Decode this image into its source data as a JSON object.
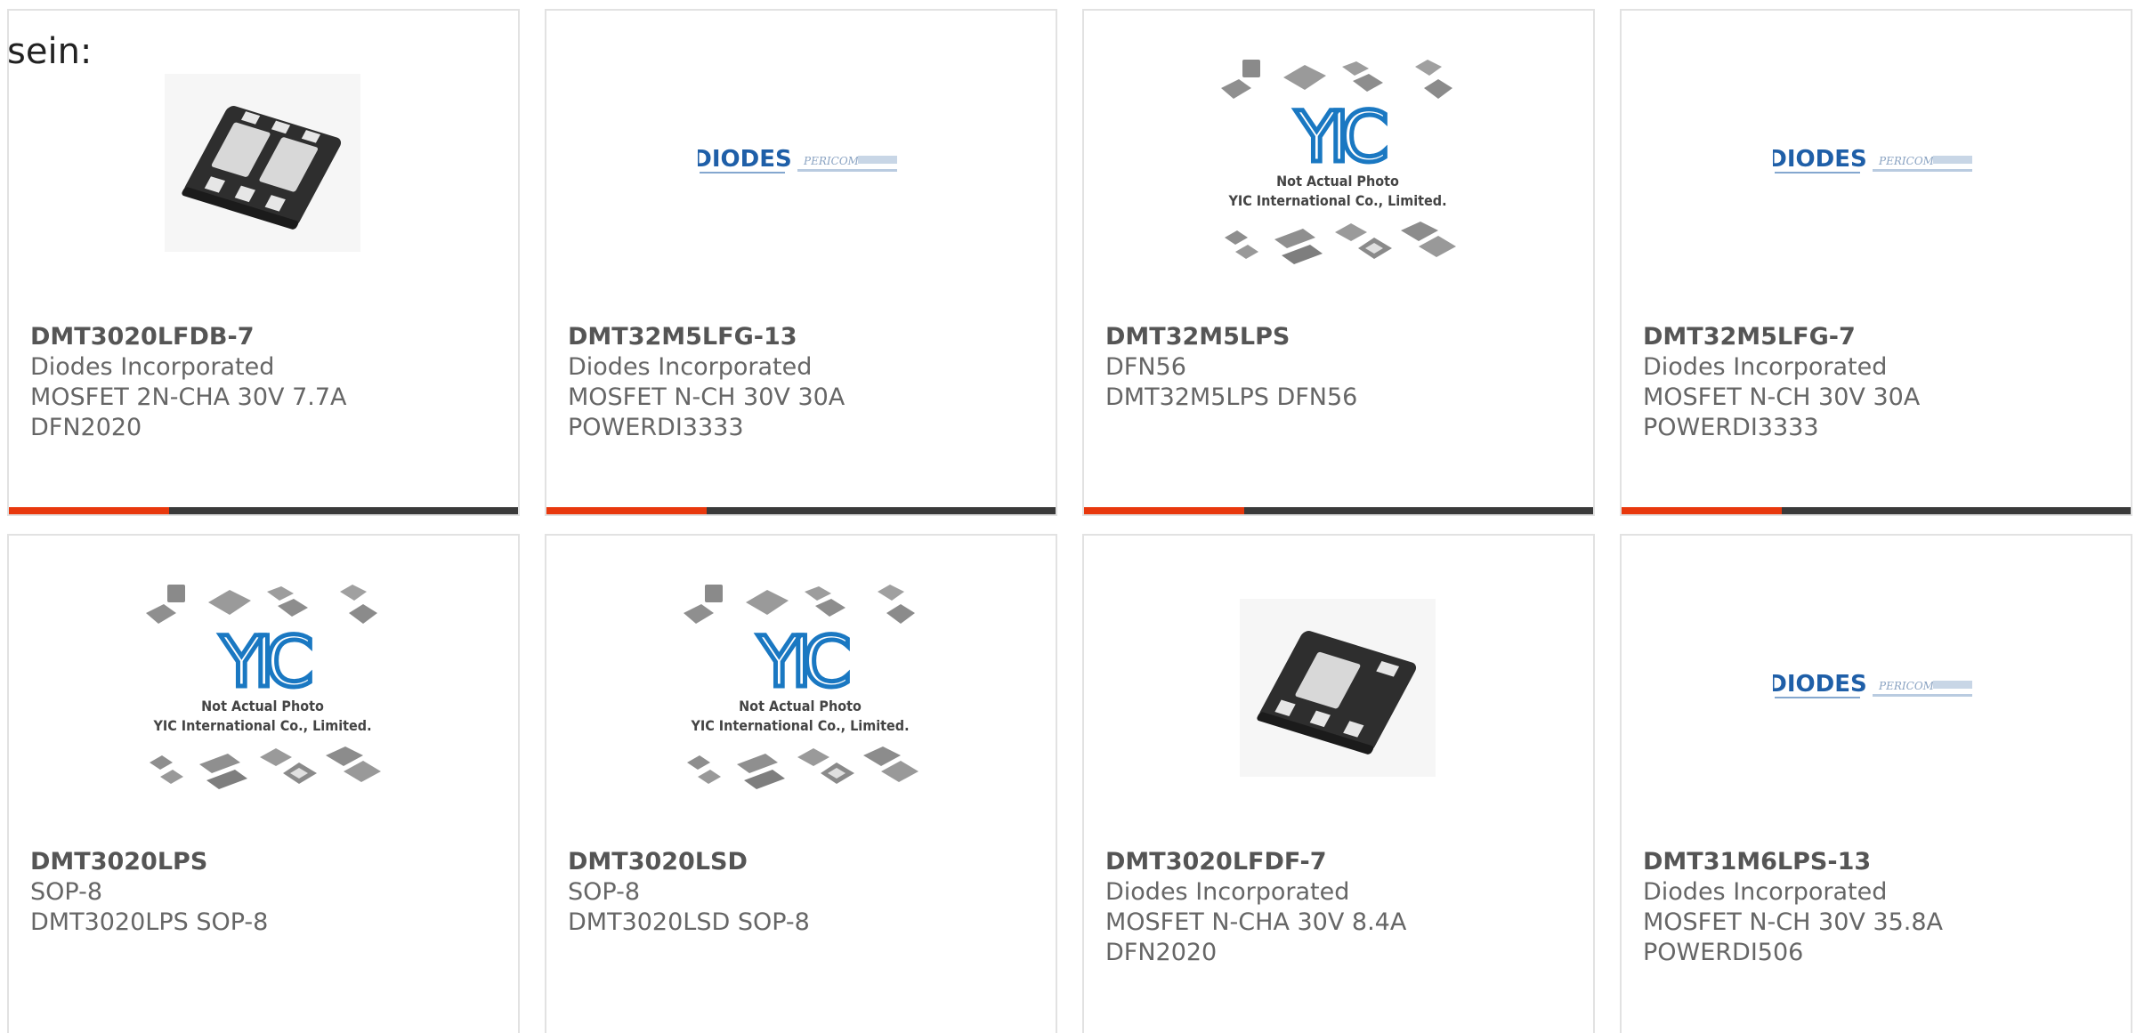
{
  "intro_text": "sein:",
  "products": [
    {
      "part": "DMT3020LFDB-7",
      "lines": [
        "Diodes Incorporated",
        "MOSFET 2N-CHA 30V 7.7A",
        "DFN2020"
      ],
      "image": "chip-6pad"
    },
    {
      "part": "DMT32M5LFG-13",
      "lines": [
        "Diodes Incorporated",
        "MOSFET N-CH 30V 30A",
        "POWERDI3333"
      ],
      "image": "diodes-pericom-logo",
      "logo": {
        "brand": "DIODES",
        "sub": "PERICOM"
      }
    },
    {
      "part": "DMT32M5LPS",
      "lines": [
        "DFN56",
        "DMT32M5LPS DFN56"
      ],
      "image": "yic-placeholder",
      "placeholder": {
        "logo": "YIC",
        "line1": "Not Actual Photo",
        "line2": "YIC International Co., Limited."
      }
    },
    {
      "part": "DMT32M5LFG-7",
      "lines": [
        "Diodes Incorporated",
        "MOSFET N-CH 30V 30A",
        "POWERDI3333"
      ],
      "image": "diodes-pericom-logo",
      "logo": {
        "brand": "DIODES",
        "sub": "PERICOM"
      }
    },
    {
      "part": "DMT3020LPS",
      "lines": [
        "SOP-8",
        "DMT3020LPS SOP-8"
      ],
      "image": "yic-placeholder",
      "placeholder": {
        "logo": "YIC",
        "line1": "Not Actual Photo",
        "line2": "YIC International Co., Limited."
      }
    },
    {
      "part": "DMT3020LSD",
      "lines": [
        "SOP-8",
        "DMT3020LSD SOP-8"
      ],
      "image": "yic-placeholder",
      "placeholder": {
        "logo": "YIC",
        "line1": "Not Actual Photo",
        "line2": "YIC International Co., Limited."
      }
    },
    {
      "part": "DMT3020LFDF-7",
      "lines": [
        "Diodes Incorporated",
        "MOSFET N-CHA 30V 8.4A",
        "DFN2020"
      ],
      "image": "chip-4pad"
    },
    {
      "part": "DMT31M6LPS-13",
      "lines": [
        "Diodes Incorporated",
        "MOSFET N-CH 30V 35.8A",
        "POWERDI506"
      ],
      "image": "diodes-pericom-logo",
      "logo": {
        "brand": "DIODES",
        "sub": "PERICOM"
      }
    }
  ],
  "colors": {
    "accent": "#e8380d",
    "bar": "#3a3a3a",
    "diodes_blue": "#1f5fa8",
    "yic_blue": "#1a78c2"
  }
}
